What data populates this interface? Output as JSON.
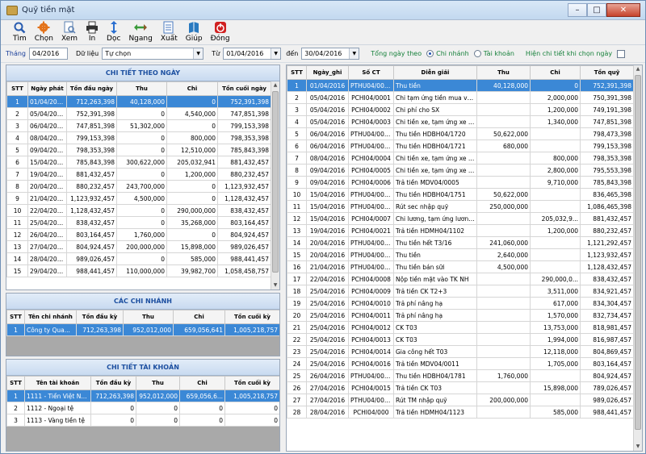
{
  "window": {
    "title": "Quỹ tiền mặt"
  },
  "toolbar": [
    {
      "label": "Tìm",
      "icon": "search-icon",
      "color": "#2a5db0"
    },
    {
      "label": "Chọn",
      "icon": "gear-icon",
      "color": "#e3731b"
    },
    {
      "label": "Xem",
      "icon": "preview-icon",
      "color": "#5a7fb0"
    },
    {
      "label": "In",
      "icon": "printer-icon",
      "color": "#333333"
    },
    {
      "label": "Dọc",
      "icon": "portrait-icon",
      "color": "#2a6fd0"
    },
    {
      "label": "Ngang",
      "icon": "landscape-icon",
      "color": "#3a9a3a"
    },
    {
      "label": "Xuất",
      "icon": "export-icon",
      "color": "#4a7abf"
    },
    {
      "label": "Giúp",
      "icon": "help-book-icon",
      "color": "#2a7ac0"
    },
    {
      "label": "Đóng",
      "icon": "power-icon",
      "color": "#d02020"
    }
  ],
  "filter": {
    "month_label": "Tháng",
    "month_value": "04/2016",
    "data_label": "Dữ liệu",
    "data_value": "Tự chọn",
    "from_label": "Từ",
    "from_value": "01/04/2016",
    "to_label": "đến",
    "to_value": "30/04/2016",
    "group_label": "Tổng ngày theo",
    "radio_branch": "Chi nhánh",
    "radio_account": "Tài khoản",
    "detail_label": "Hiện chi tiết khi chọn ngày"
  },
  "daily": {
    "title": "CHI TIẾT THEO NGÀY",
    "columns": [
      "STT",
      "Ngày phát",
      "Tồn đầu ngày",
      "Thu",
      "Chi",
      "Tồn cuối ngày"
    ],
    "rows": [
      [
        "1",
        "01/04/2016",
        "712,263,398",
        "40,128,000",
        "0",
        "752,391,398"
      ],
      [
        "2",
        "05/04/2016",
        "752,391,398",
        "0",
        "4,540,000",
        "747,851,398"
      ],
      [
        "3",
        "06/04/2016",
        "747,851,398",
        "51,302,000",
        "0",
        "799,153,398"
      ],
      [
        "4",
        "08/04/2016",
        "799,153,398",
        "0",
        "800,000",
        "798,353,398"
      ],
      [
        "5",
        "09/04/2016",
        "798,353,398",
        "0",
        "12,510,000",
        "785,843,398"
      ],
      [
        "6",
        "15/04/2016",
        "785,843,398",
        "300,622,000",
        "205,032,941",
        "881,432,457"
      ],
      [
        "7",
        "19/04/2016",
        "881,432,457",
        "0",
        "1,200,000",
        "880,232,457"
      ],
      [
        "8",
        "20/04/2016",
        "880,232,457",
        "243,700,000",
        "0",
        "1,123,932,457"
      ],
      [
        "9",
        "21/04/2016",
        "1,123,932,457",
        "4,500,000",
        "0",
        "1,128,432,457"
      ],
      [
        "10",
        "22/04/2016",
        "1,128,432,457",
        "0",
        "290,000,000",
        "838,432,457"
      ],
      [
        "11",
        "25/04/2016",
        "838,432,457",
        "0",
        "35,268,000",
        "803,164,457"
      ],
      [
        "12",
        "26/04/2016",
        "803,164,457",
        "1,760,000",
        "0",
        "804,924,457"
      ],
      [
        "13",
        "27/04/2016",
        "804,924,457",
        "200,000,000",
        "15,898,000",
        "989,026,457"
      ],
      [
        "14",
        "28/04/2016",
        "989,026,457",
        "0",
        "585,000",
        "988,441,457"
      ],
      [
        "15",
        "29/04/2016",
        "988,441,457",
        "110,000,000",
        "39,982,700",
        "1,058,458,757"
      ]
    ]
  },
  "branches": {
    "title": "CÁC CHI NHÁNH",
    "columns": [
      "STT",
      "Tên chi nhánh",
      "Tồn đầu kỳ",
      "Thu",
      "Chi",
      "Tồn cuối kỳ"
    ],
    "rows": [
      [
        "1",
        "Công ty Qua...",
        "712,263,398",
        "952,012,000",
        "659,056,641",
        "1,005,218,757"
      ]
    ]
  },
  "accounts": {
    "title": "CHI TIẾT TÀI KHOẢN",
    "columns": [
      "STT",
      "Tên tài khoản",
      "Tồn đầu kỳ",
      "Thu",
      "Chi",
      "Tồn cuối kỳ"
    ],
    "rows": [
      [
        "1",
        "1111 - Tiền Việt N...",
        "712,263,398",
        "952,012,000",
        "659,056,6...",
        "1,005,218,757"
      ],
      [
        "2",
        "1112 - Ngoại tệ",
        "0",
        "0",
        "0",
        "0"
      ],
      [
        "3",
        "1113 - Vàng tiền tệ",
        "0",
        "0",
        "0",
        "0"
      ]
    ]
  },
  "ledger": {
    "columns": [
      "STT",
      "Ngày_ghi",
      "Số CT",
      "Diễn giải",
      "Thu",
      "Chi",
      "Tồn quỹ"
    ],
    "rows": [
      [
        "1",
        "01/04/2016",
        "PTHU04/0002",
        "Thu tiền",
        "40,128,000",
        "0",
        "752,391,398"
      ],
      [
        "2",
        "05/04/2016",
        "PCHI04/0001",
        "Chi tạm ứng tiền mua vật tư",
        "",
        "2,000,000",
        "750,391,398"
      ],
      [
        "3",
        "05/04/2016",
        "PCHI04/0002",
        "Chi phí cho SX",
        "",
        "1,200,000",
        "749,191,398"
      ],
      [
        "4",
        "05/04/2016",
        "PCHI04/0003",
        "Chi tiền xe, tạm ứng xe T03",
        "",
        "1,340,000",
        "747,851,398"
      ],
      [
        "5",
        "06/04/2016",
        "PTHU04/0003",
        "Thu tiền HDBH04/1720",
        "50,622,000",
        "",
        "798,473,398"
      ],
      [
        "6",
        "06/04/2016",
        "PTHU04/0004",
        "Thu tiền HDBH04/1721",
        "680,000",
        "",
        "799,153,398"
      ],
      [
        "7",
        "08/04/2016",
        "PCHI04/0004",
        "Chi tiền xe, tạm ứng xe T03",
        "",
        "800,000",
        "798,353,398"
      ],
      [
        "8",
        "09/04/2016",
        "PCHI04/0005",
        "Chi tiền xe, tạm ứng xe T3",
        "",
        "2,800,000",
        "795,553,398"
      ],
      [
        "9",
        "09/04/2016",
        "PCHI04/0006",
        "Trả tiền MDV04/0005",
        "",
        "9,710,000",
        "785,843,398"
      ],
      [
        "10",
        "15/04/2016",
        "PTHU04/0005",
        "Thu tiền HDBH04/1751",
        "50,622,000",
        "",
        "836,465,398"
      ],
      [
        "11",
        "15/04/2016",
        "PTHU04/0006",
        "Rút sec nhập quỹ",
        "250,000,000",
        "",
        "1,086,465,398"
      ],
      [
        "12",
        "15/04/2016",
        "PCHI04/0007",
        "Chi lương, tạm ứng lương ...",
        "",
        "205,032,9...",
        "881,432,457"
      ],
      [
        "13",
        "19/04/2016",
        "PCHI04/0021",
        "Trả tiền HDMH04/1102",
        "",
        "1,200,000",
        "880,232,457"
      ],
      [
        "14",
        "20/04/2016",
        "PTHU04/0007",
        "Thu tiền hết T3/16",
        "241,060,000",
        "",
        "1,121,292,457"
      ],
      [
        "15",
        "20/04/2016",
        "PTHU04/0008",
        "Thu tiền",
        "2,640,000",
        "",
        "1,123,932,457"
      ],
      [
        "16",
        "21/04/2016",
        "PTHU04/0009",
        "Thu tiền bán sữi",
        "4,500,000",
        "",
        "1,128,432,457"
      ],
      [
        "17",
        "22/04/2016",
        "PCHI04/0008",
        "Nộp tiền mặt vào TK NH",
        "",
        "290,000,0...",
        "838,432,457"
      ],
      [
        "18",
        "25/04/2016",
        "PCHI04/0009",
        "Trả tiền CK T2+3",
        "",
        "3,511,000",
        "834,921,457"
      ],
      [
        "19",
        "25/04/2016",
        "PCHI04/0010",
        "Trả phí nâng hạ",
        "",
        "617,000",
        "834,304,457"
      ],
      [
        "20",
        "25/04/2016",
        "PCHI04/0011",
        "Trả phí nâng hạ",
        "",
        "1,570,000",
        "832,734,457"
      ],
      [
        "21",
        "25/04/2016",
        "PCHI04/0012",
        "CK T03",
        "",
        "13,753,000",
        "818,981,457"
      ],
      [
        "22",
        "25/04/2016",
        "PCHI04/0013",
        "CK T03",
        "",
        "1,994,000",
        "816,987,457"
      ],
      [
        "23",
        "25/04/2016",
        "PCHI04/0014",
        "Gia công hết T03",
        "",
        "12,118,000",
        "804,869,457"
      ],
      [
        "24",
        "25/04/2016",
        "PCHI04/0016",
        "Trả tiền MDV04/0011",
        "",
        "1,705,000",
        "803,164,457"
      ],
      [
        "25",
        "26/04/2016",
        "PTHU04/0010",
        "Thu tiền HDBH04/1781",
        "1,760,000",
        "",
        "804,924,457"
      ],
      [
        "26",
        "27/04/2016",
        "PCHI04/0015",
        "Trả tiền CK T03",
        "",
        "15,898,000",
        "789,026,457"
      ],
      [
        "27",
        "27/04/2016",
        "PTHU04/0000",
        "Rút TM nhập quỹ",
        "200,000,000",
        "",
        "989,026,457"
      ],
      [
        "28",
        "28/04/2016",
        "PCHI04/000",
        "Trả tiền HDMH04/1123",
        "",
        "585,000",
        "988,441,457"
      ]
    ]
  }
}
